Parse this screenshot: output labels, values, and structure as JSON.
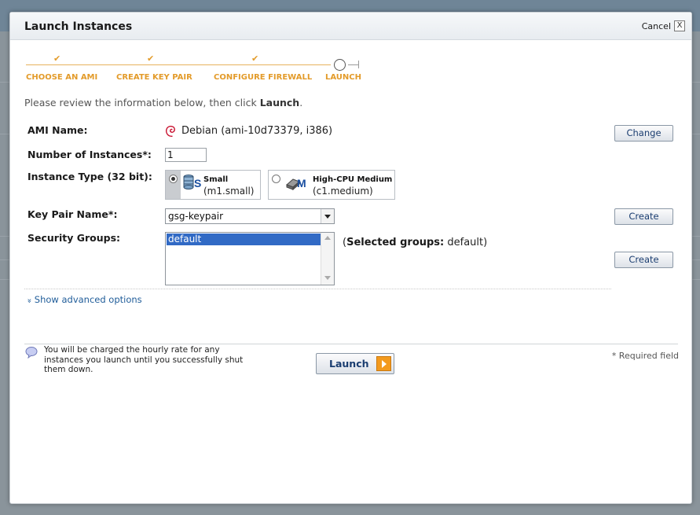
{
  "dialog": {
    "title": "Launch Instances",
    "cancel_label": "Cancel",
    "close_glyph": "X"
  },
  "wizard": {
    "check_glyph": "✔",
    "steps": [
      {
        "label": "CHOOSE AN AMI",
        "state": "done"
      },
      {
        "label": "CREATE KEY PAIR",
        "state": "done"
      },
      {
        "label": "CONFIGURE FIREWALL",
        "state": "done"
      },
      {
        "label": "LAUNCH",
        "state": "current"
      }
    ]
  },
  "intro": {
    "text": "Please review the information below, then click ",
    "bold": "Launch",
    "tail": "."
  },
  "form": {
    "ami": {
      "label": "AMI Name:",
      "value": "Debian (ami-10d73379, i386)",
      "icon": "debian-swirl-icon",
      "change_label": "Change"
    },
    "instances": {
      "label": "Number of Instances*:",
      "value": "1"
    },
    "instance_type": {
      "label": "Instance Type (32 bit):",
      "options": [
        {
          "name": "Small",
          "code": "(m1.small)",
          "badge": "S",
          "selected": true
        },
        {
          "name": "High-CPU Medium",
          "code": "(c1.medium)",
          "badge": "M",
          "selected": false
        }
      ]
    },
    "key_pair": {
      "label": "Key Pair Name*:",
      "value": "gsg-keypair",
      "create_label": "Create"
    },
    "security_groups": {
      "label": "Security Groups:",
      "selected_item": "default",
      "summary_label": "Selected groups:",
      "summary_value": "default",
      "create_label": "Create"
    }
  },
  "advanced": {
    "glyph": "»",
    "label": "Show advanced options"
  },
  "footer": {
    "notice": "You will be charged the hourly rate for any instances you launch until you successfully shut them down.",
    "launch_label": "Launch",
    "required_note": "* Required field"
  },
  "colors": {
    "accent_orange": "#e39b2a",
    "link_blue": "#1f5c99",
    "selection_blue": "#316ac5"
  }
}
